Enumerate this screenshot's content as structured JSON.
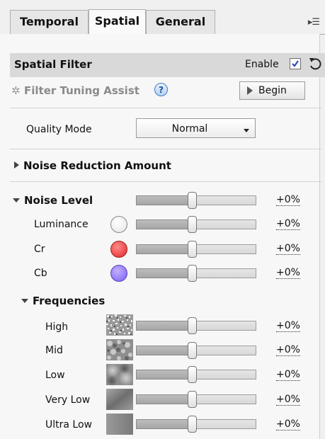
{
  "tabs": [
    {
      "label": "Temporal",
      "active": false
    },
    {
      "label": "Spatial",
      "active": true
    },
    {
      "label": "General",
      "active": false
    }
  ],
  "tab_menu_icon": "panel-menu-icon",
  "spatial_filter": {
    "title": "Spatial Filter",
    "enable_label": "Enable",
    "enabled": true
  },
  "assist": {
    "label": "Filter Tuning Assist",
    "help_glyph": "?",
    "begin_label": "Begin"
  },
  "quality": {
    "label": "Quality Mode",
    "value": "Normal"
  },
  "noise_reduction": {
    "label": "Noise Reduction Amount",
    "expanded": false
  },
  "noise_level": {
    "label": "Noise Level",
    "expanded": true,
    "value": "+0%",
    "level": 0.5,
    "channels": [
      {
        "label": "Luminance",
        "value": "+0%",
        "level": 0.5,
        "color": "#ffffff"
      },
      {
        "label": "Cr",
        "value": "+0%",
        "level": 0.5,
        "color": "#e83232"
      },
      {
        "label": "Cb",
        "value": "+0%",
        "level": 0.5,
        "color": "#8866ee"
      }
    ]
  },
  "frequencies": {
    "label": "Frequencies",
    "expanded": true,
    "items": [
      {
        "label": "High",
        "value": "+0%",
        "level": 0.5
      },
      {
        "label": "Mid",
        "value": "+0%",
        "level": 0.5
      },
      {
        "label": "Low",
        "value": "+0%",
        "level": 0.5
      },
      {
        "label": "Very Low",
        "value": "+0%",
        "level": 0.5
      },
      {
        "label": "Ultra Low",
        "value": "+0%",
        "level": 0.5
      }
    ]
  }
}
